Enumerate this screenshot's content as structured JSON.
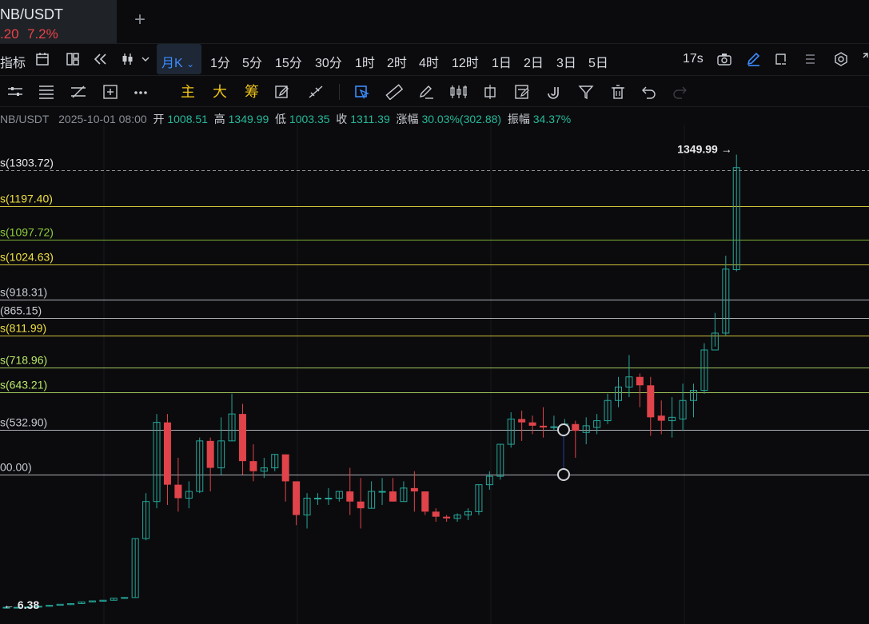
{
  "tab": {
    "symbol": "NB/USDT",
    "price": ".20",
    "change": "7.2%",
    "add_icon": "plus-icon"
  },
  "timeframes": {
    "indicators_label": "指标",
    "active": "月K",
    "items": [
      "1分",
      "5分",
      "15分",
      "30分",
      "1时",
      "2时",
      "4时",
      "12时",
      "1日",
      "2日",
      "3日",
      "5日"
    ],
    "refresh": "17s"
  },
  "drawbar": {
    "main": "主",
    "big": "大",
    "chip": "筹"
  },
  "info": {
    "symbol": "NB/USDT",
    "date": "2025-10-01 08:00",
    "open_label": "开",
    "open": "1008.51",
    "high_label": "高",
    "high": "1349.99",
    "low_label": "低",
    "low": "1003.35",
    "close_label": "收",
    "close": "1311.39",
    "chg_label": "涨幅",
    "chg": "30.03%(302.88)",
    "amp_label": "振幅",
    "amp": "34.37%"
  },
  "levels": [
    {
      "label": "s(1303.72)",
      "price": 1303.72,
      "color": "#e8eaed",
      "dashed": true
    },
    {
      "label": "s(1197.40)",
      "price": 1197.4,
      "color": "#f0e040"
    },
    {
      "label": "s(1097.72)",
      "price": 1097.72,
      "color": "#8fcf3c"
    },
    {
      "label": "s(1024.63)",
      "price": 1024.63,
      "color": "#f0e040"
    },
    {
      "label": "s(918.31)",
      "price": 918.31,
      "color": "#c8ccd2"
    },
    {
      "label": "(865.15)",
      "price": 865.15,
      "color": "#c8ccd2"
    },
    {
      "label": "s(811.99)",
      "price": 811.99,
      "color": "#f0e040"
    },
    {
      "label": "s(718.96)",
      "price": 718.96,
      "color": "#b9e86a"
    },
    {
      "label": "s(643.21)",
      "price": 643.21,
      "color": "#b9e86a"
    },
    {
      "label": "s(532.90)",
      "price": 532.9,
      "color": "#c8ccd2"
    },
    {
      "label": "00.00)",
      "price": 400.0,
      "color": "#c8ccd2"
    }
  ],
  "markers": {
    "high_label": "1349.99",
    "low_label": "6.38"
  },
  "colors": {
    "up": "#26a69a",
    "down": "#e0434a",
    "bg": "#0b0b0d",
    "accent": "#3b8cff"
  },
  "chart_data": {
    "type": "candlestick",
    "period": "月K",
    "candles": [
      [
        6,
        6,
        6,
        6
      ],
      [
        6,
        6,
        6,
        6
      ],
      [
        6,
        7,
        7,
        6
      ],
      [
        7,
        9,
        9,
        7
      ],
      [
        9,
        12,
        12,
        9
      ],
      [
        12,
        15,
        14,
        14
      ],
      [
        14,
        17,
        17,
        13
      ],
      [
        17,
        22,
        22,
        16
      ],
      [
        22,
        25,
        24,
        23
      ],
      [
        24,
        27,
        27,
        23
      ],
      [
        27,
        33,
        33,
        26
      ],
      [
        33,
        35,
        35,
        31
      ],
      [
        35,
        210,
        210,
        35
      ],
      [
        210,
        320,
        345,
        205
      ],
      [
        320,
        555,
        580,
        300
      ],
      [
        555,
        370,
        580,
        310
      ],
      [
        370,
        330,
        450,
        290
      ],
      [
        330,
        350,
        380,
        300
      ],
      [
        350,
        500,
        510,
        345
      ],
      [
        500,
        420,
        510,
        350
      ],
      [
        420,
        500,
        570,
        400
      ],
      [
        500,
        580,
        640,
        500
      ],
      [
        580,
        440,
        610,
        400
      ],
      [
        440,
        410,
        490,
        380
      ],
      [
        410,
        420,
        450,
        390
      ],
      [
        420,
        460,
        460,
        410
      ],
      [
        460,
        380,
        460,
        320
      ],
      [
        380,
        280,
        380,
        250
      ],
      [
        280,
        330,
        345,
        240
      ],
      [
        330,
        330,
        345,
        310
      ],
      [
        330,
        330,
        360,
        310
      ],
      [
        330,
        350,
        350,
        320
      ],
      [
        350,
        320,
        420,
        280
      ],
      [
        320,
        300,
        390,
        240
      ],
      [
        300,
        350,
        380,
        300
      ],
      [
        350,
        350,
        390,
        310
      ],
      [
        350,
        320,
        390,
        320
      ],
      [
        320,
        360,
        380,
        320
      ],
      [
        360,
        350,
        410,
        290
      ],
      [
        350,
        290,
        350,
        280
      ],
      [
        290,
        275,
        300,
        260
      ],
      [
        275,
        270,
        280,
        260
      ],
      [
        270,
        280,
        285,
        260
      ],
      [
        280,
        290,
        300,
        265
      ],
      [
        290,
        370,
        370,
        280
      ],
      [
        370,
        395,
        410,
        355
      ],
      [
        395,
        490,
        490,
        385
      ],
      [
        490,
        565,
        585,
        480
      ],
      [
        565,
        555,
        590,
        500
      ],
      [
        555,
        545,
        575,
        520
      ],
      [
        545,
        540,
        600,
        510
      ],
      [
        540,
        542,
        575,
        530
      ],
      [
        542,
        550,
        565,
        528
      ],
      [
        550,
        530,
        560,
        450
      ],
      [
        525,
        545,
        570,
        490
      ],
      [
        540,
        560,
        580,
        520
      ],
      [
        560,
        620,
        640,
        550
      ],
      [
        620,
        660,
        690,
        600
      ],
      [
        660,
        690,
        755,
        630
      ],
      [
        690,
        665,
        700,
        600
      ],
      [
        665,
        570,
        690,
        515
      ],
      [
        575,
        560,
        620,
        520
      ],
      [
        560,
        570,
        630,
        510
      ],
      [
        565,
        620,
        670,
        530
      ],
      [
        620,
        650,
        670,
        570
      ],
      [
        650,
        770,
        790,
        640
      ],
      [
        770,
        820,
        880,
        780
      ],
      [
        820,
        1010,
        1050,
        810
      ],
      [
        1008.51,
        1311.39,
        1349.99,
        1003.35
      ]
    ],
    "price_levels": [
      1303.72,
      1197.4,
      1097.72,
      1024.63,
      918.31,
      865.15,
      811.99,
      718.96,
      643.21,
      532.9,
      400.0
    ],
    "high_marker": 1349.99,
    "low_marker": 6.38
  }
}
